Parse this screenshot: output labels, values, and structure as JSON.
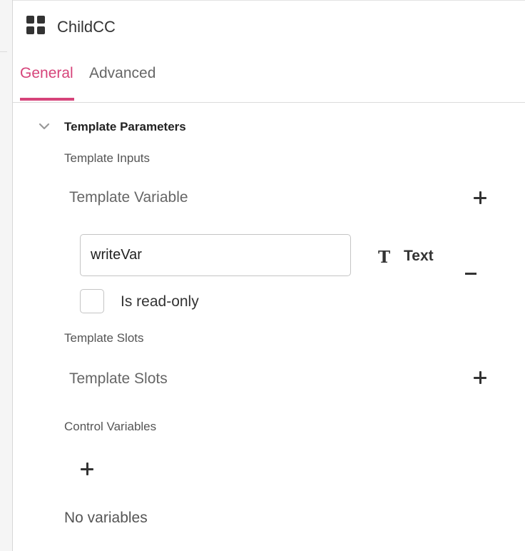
{
  "header": {
    "title": "ChildCC",
    "icon": "grid-icon"
  },
  "tabs": [
    {
      "label": "General",
      "active": true
    },
    {
      "label": "Advanced",
      "active": false
    }
  ],
  "colors": {
    "accent": "#d6447a",
    "text_muted": "#666666",
    "border": "#c4c4c4"
  },
  "section": {
    "title": "Template Parameters",
    "expanded": true,
    "template_inputs": {
      "label": "Template Inputs",
      "row_label": "Template Variable",
      "variables": [
        {
          "name": "writeVar",
          "type_icon": "T",
          "type_label": "Text",
          "read_only": false,
          "read_only_label": "Is read-only"
        }
      ]
    },
    "template_slots": {
      "label": "Template Slots",
      "row_label": "Template Slots"
    },
    "control_variables": {
      "label": "Control Variables",
      "empty_text": "No variables"
    }
  }
}
